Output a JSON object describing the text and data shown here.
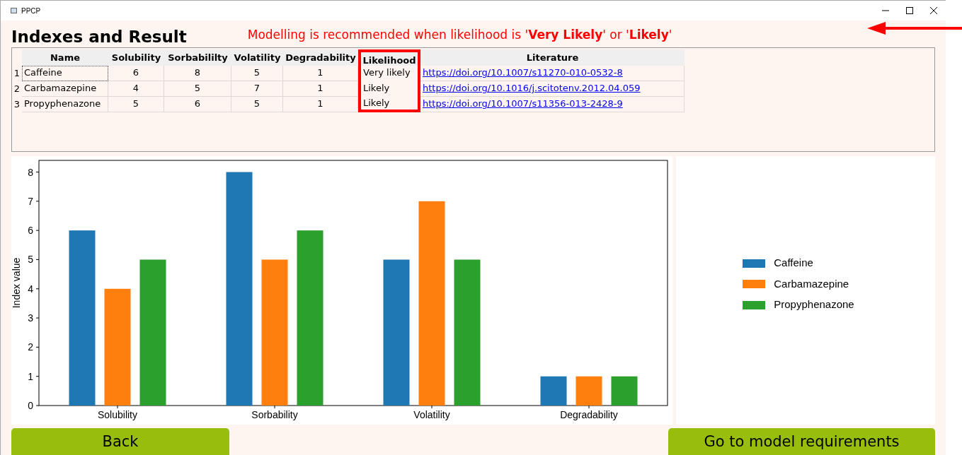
{
  "window": {
    "title": "PPCP"
  },
  "heading": "Indexes and Result",
  "notice": "Modelling is recommended when likelihood is '**Very Likely**' or '**Likely**'",
  "table": {
    "columns": [
      {
        "label": "Name",
        "highlighted": false
      },
      {
        "label": "Solubility",
        "highlighted": false
      },
      {
        "label": "Sorbabililty",
        "highlighted": false
      },
      {
        "label": "Volatility",
        "highlighted": false
      },
      {
        "label": "Degradability",
        "highlighted": false
      },
      {
        "label": "Likelihood",
        "highlighted": true
      },
      {
        "label": "Literature",
        "highlighted": false
      }
    ],
    "rows": [
      {
        "index": "1",
        "cells": [
          "Caffeine",
          "6",
          "8",
          "5",
          "1",
          "Very likely",
          "https://doi.org/10.1007/s11270-010-0532-8"
        ],
        "focused": true
      },
      {
        "index": "2",
        "cells": [
          "Carbamazepine",
          "4",
          "5",
          "7",
          "1",
          "Likely",
          "https://doi.org/10.1016/j.scitotenv.2012.04.059"
        ],
        "focused": false
      },
      {
        "index": "3",
        "cells": [
          "Propyphenazone",
          "5",
          "6",
          "5",
          "1",
          "Likely",
          "https://doi.org/10.1007/s11356-013-2428-9"
        ],
        "focused": false
      }
    ]
  },
  "chart": {
    "chart_data": {
      "type": "bar",
      "ylabel": "Index value",
      "categories": [
        "Solubility",
        "Sorbability",
        "Volatility",
        "Degradability"
      ],
      "series": [
        {
          "name": "Caffeine",
          "color": "#1f77b4",
          "values": [
            6,
            8,
            5,
            1
          ]
        },
        {
          "name": "Carbamazepine",
          "color": "#ff7f0e",
          "values": [
            4,
            5,
            7,
            1
          ]
        },
        {
          "name": "Propyphenazone",
          "color": "#2ca02c",
          "values": [
            5,
            6,
            5,
            1
          ]
        }
      ],
      "ylim": [
        0,
        8.4
      ],
      "yticks": [
        0,
        1,
        2,
        3,
        4,
        5,
        6,
        7,
        8
      ]
    }
  },
  "buttons": [
    {
      "label": "Back"
    },
    {
      "label": "Go to model requirements"
    }
  ]
}
